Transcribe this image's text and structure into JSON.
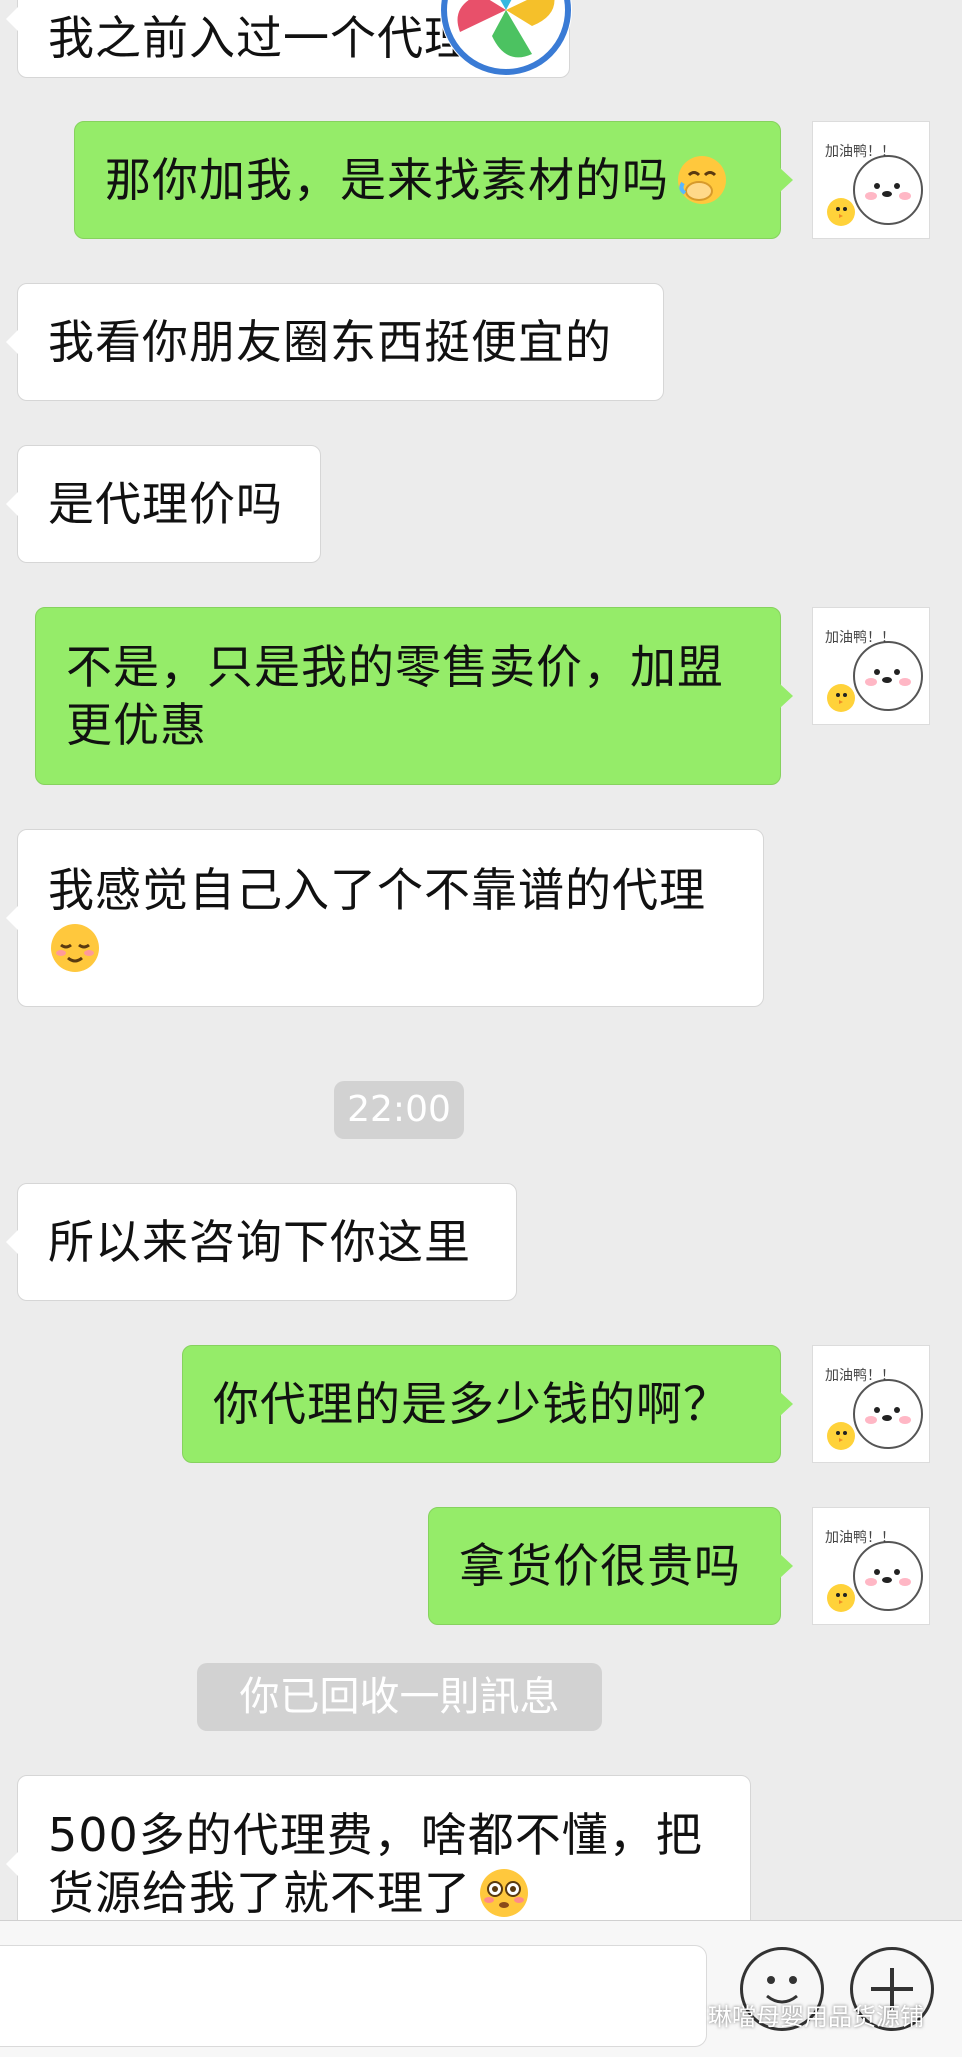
{
  "messages": [
    {
      "side": "left",
      "text": "我之前入过一个代理"
    },
    {
      "side": "right",
      "text": "那你加我，是来找素材的吗",
      "emoji": "face-with-hand-over-mouth"
    },
    {
      "side": "left",
      "text": "我看你朋友圈东西挺便宜的"
    },
    {
      "side": "left",
      "text": "是代理价吗"
    },
    {
      "side": "right",
      "lines": [
        "不是，只是我的零售卖价，加盟",
        "更优惠"
      ]
    },
    {
      "side": "left",
      "lines": [
        "我感觉自己入了个不靠谱的代理"
      ],
      "emoji": "relieved-face"
    },
    {
      "side": "left",
      "text": "所以来咨询下你这里"
    },
    {
      "side": "right",
      "text": "你代理的是多少钱的啊？"
    },
    {
      "side": "right",
      "text": "拿货价很贵吗"
    },
    {
      "side": "left",
      "lines": [
        "500多的代理费，啥都不懂，把",
        "货源给我了就不理了"
      ],
      "emoji": "flushed-face"
    }
  ],
  "timestamp": "22:00",
  "recall_notice": "你已回收一則訊息",
  "avatar_sticker_text": "加油鸭！！",
  "input_bar": {
    "watermark": "琳噹母婴用品货源铺",
    "emoji_button_icon": "smiley-icon",
    "plus_button_icon": "plus-icon"
  },
  "colors": {
    "background": "#ececec",
    "outgoing_bubble": "#95ec69",
    "incoming_bubble": "#ffffff",
    "pill": "#d2d2d2"
  }
}
